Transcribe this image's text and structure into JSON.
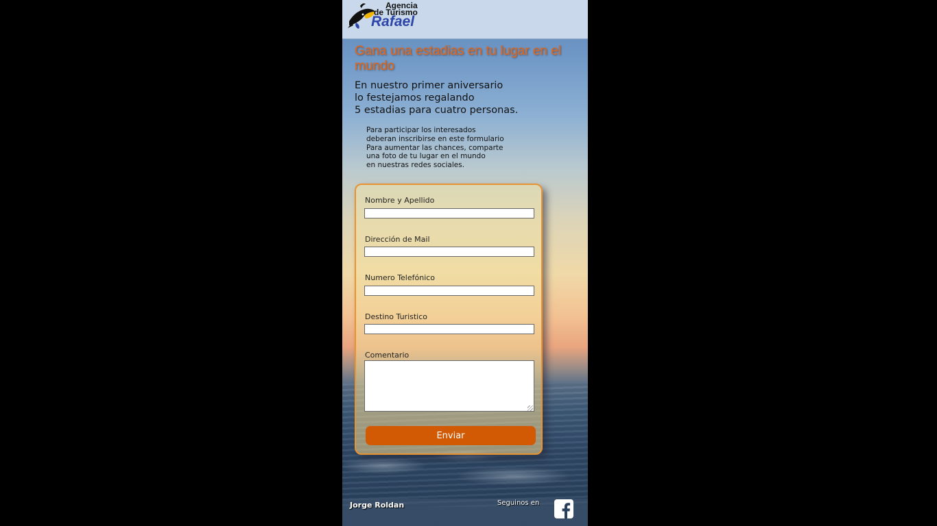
{
  "header": {
    "logo_line1": "Agencia",
    "logo_line2": "de Turismo",
    "logo_line3": "Rafael",
    "logo_icon": "toucan-icon"
  },
  "hero": {
    "headline": "Gana una estadias en tu lugar en el mundo",
    "subtitle_lines": [
      "En nuestro primer aniversario",
      "lo festejamos regalando",
      "5 estadias para cuatro personas."
    ],
    "info_lines": [
      "Para participar los interesados",
      "deberan inscribirse en este formulario",
      "Para aumentar las chances, comparte",
      "una foto de tu lugar en el mundo",
      "en nuestras redes sociales."
    ]
  },
  "form": {
    "name_label": "Nombre y Apellido",
    "name_value": "",
    "email_label": "Dirección de Mail",
    "email_value": "",
    "phone_label": "Numero Telefónico",
    "phone_value": "",
    "destination_label": "Destino Turistico",
    "destination_value": "",
    "comment_label": "Comentario",
    "comment_value": "",
    "submit_label": "Enviar"
  },
  "footer": {
    "author": "Jorge Roldan",
    "follow_label": "Seguinos en",
    "social_icon": "facebook-icon"
  },
  "colors": {
    "accent": "#d25a05",
    "headline": "#e4661a",
    "logo_text": "#2c45a8",
    "card_border": "#e8932f"
  }
}
